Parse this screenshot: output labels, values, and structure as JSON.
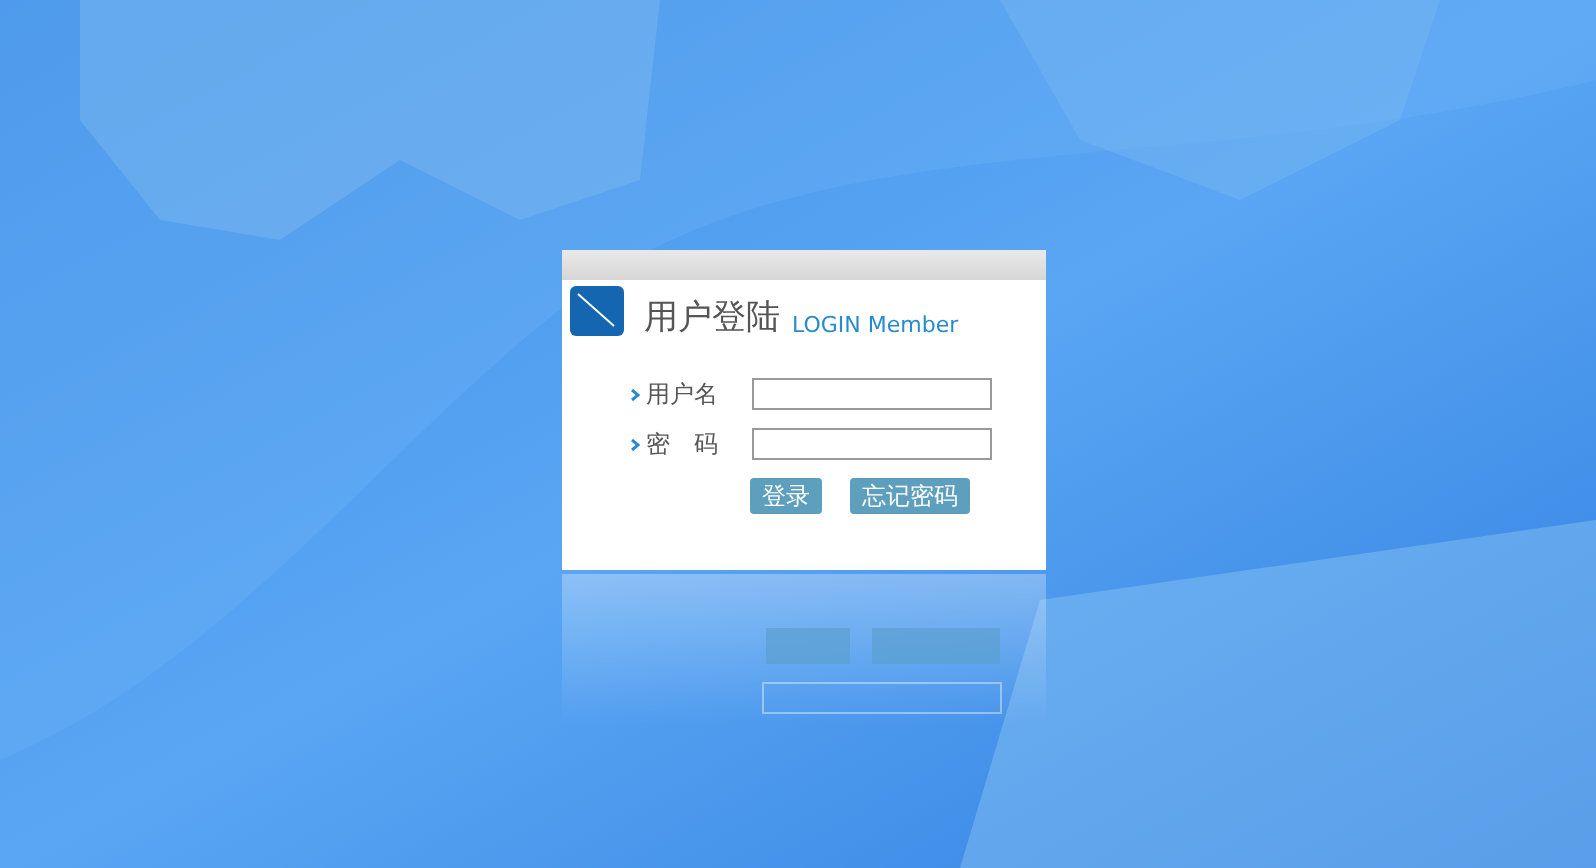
{
  "login": {
    "title": "用户登陆",
    "subtitle": "LOGIN Member",
    "fields": [
      {
        "label": "用户名"
      },
      {
        "label": "密　码"
      }
    ],
    "buttons": [
      "登录",
      "忘记密码"
    ]
  }
}
